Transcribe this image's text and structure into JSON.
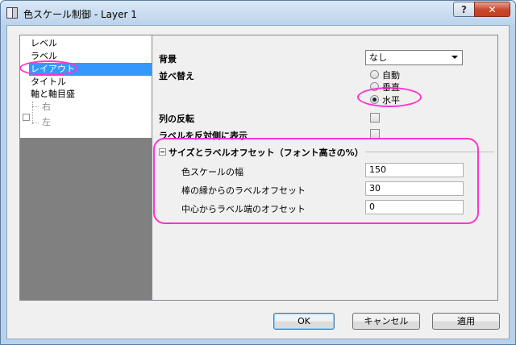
{
  "window": {
    "title": "色スケール制御 - Layer 1",
    "help_label": "?",
    "close_label": "✕"
  },
  "tree": {
    "items": [
      {
        "label": "レベル"
      },
      {
        "label": "ラベル"
      },
      {
        "label": "レイアウト"
      },
      {
        "label": "タイトル"
      },
      {
        "label": "軸と軸目盛"
      },
      {
        "label": "右"
      },
      {
        "label": "左"
      }
    ],
    "selected_index": 2,
    "expander_label": "□"
  },
  "form": {
    "background_label": "背景",
    "background_value": "なし",
    "sort_label": "並べ替え",
    "radio_options": [
      {
        "label": "自動",
        "checked": false
      },
      {
        "label": "垂直",
        "checked": false
      },
      {
        "label": "水平",
        "checked": true
      }
    ],
    "reverse_label": "列の反転",
    "reverse_checked": false,
    "opposite_label": "ラベルを反対側に表示",
    "opposite_checked": false,
    "group_title": "サイズとラベルオフセット（フォント高さの%）",
    "fields": [
      {
        "label": "色スケールの幅",
        "value": "150"
      },
      {
        "label": "棒の縁からのラベルオフセット",
        "value": "30"
      },
      {
        "label": "中心からラベル端のオフセット",
        "value": "0"
      }
    ]
  },
  "buttons": {
    "ok": "OK",
    "cancel": "キャンセル",
    "apply": "適用"
  },
  "colors": {
    "highlight": "#ff33cc",
    "selection": "#3399ff"
  }
}
